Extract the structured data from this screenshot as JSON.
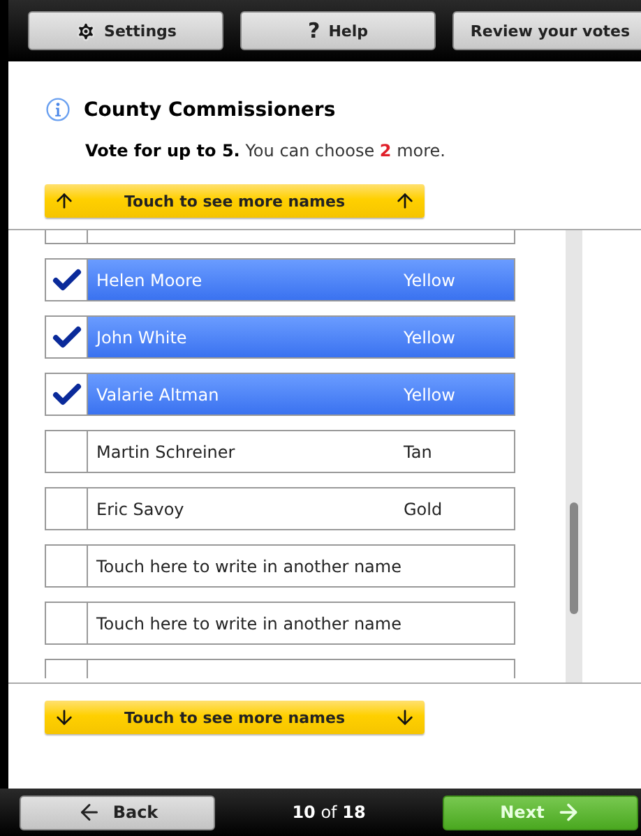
{
  "toolbar": [
    {
      "kind": "settings",
      "label": "Settings"
    },
    {
      "kind": "help",
      "glyph": "?",
      "label": "Help"
    },
    {
      "kind": "review",
      "label": "Review your votes"
    }
  ],
  "contest": {
    "title": "County Commissioners",
    "instructions": "**Vote for up to 5.** You can choose **2** more."
  },
  "scroll_up": {
    "label": "Touch to see more names"
  },
  "rows": [
    {
      "kind": "cut_top"
    },
    {
      "kind": "candidate",
      "name": "Helen Moore",
      "party": "Yellow",
      "checked": true
    },
    {
      "kind": "candidate",
      "name": "John White",
      "party": "Yellow",
      "checked": true
    },
    {
      "kind": "candidate",
      "name": "Valarie Altman",
      "party": "Yellow",
      "checked": true
    },
    {
      "kind": "candidate",
      "name": "Martin Schreiner",
      "party": "Tan",
      "checked": false
    },
    {
      "kind": "candidate",
      "name": "Eric Savoy",
      "party": "Gold",
      "checked": false
    },
    {
      "kind": "write_in",
      "label": "Touch here to write in another name",
      "checked": false
    },
    {
      "kind": "write_in",
      "label": "Touch here to write in another name",
      "checked": false
    },
    {
      "kind": "cut_bottom"
    }
  ],
  "scroll_down": {
    "label": "Touch to see more names"
  },
  "footer": {
    "back": "Back",
    "progress": "**10** of **18**",
    "next": "Next"
  }
}
